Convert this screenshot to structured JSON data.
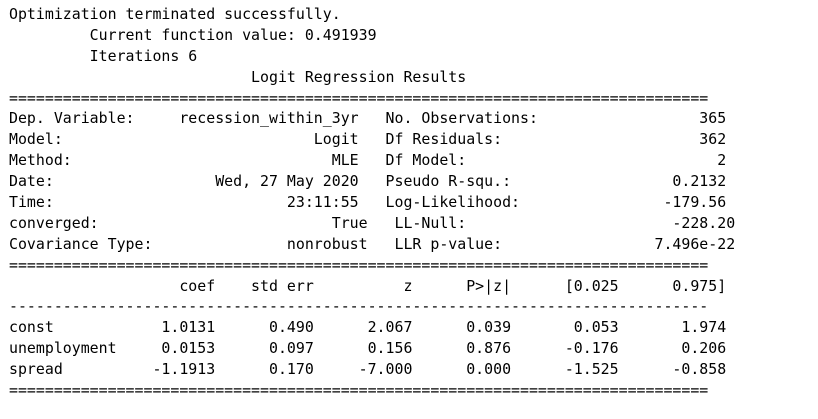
{
  "output_lines": [
    "Optimization terminated successfully.",
    "         Current function value: 0.491939",
    "         Iterations 6",
    "                           Logit Regression Results                           ",
    "==============================================================================",
    "Dep. Variable:     recession_within_3yr   No. Observations:                  365",
    "Model:                            Logit   Df Residuals:                      362",
    "Method:                             MLE   Df Model:                            2",
    "Date:                  Wed, 27 May 2020   Pseudo R-squ.:                  0.2132",
    "Time:                          23:11:55   Log-Likelihood:                -179.56",
    "converged:                          True   LL-Null:                       -228.20",
    "Covariance Type:               nonrobust   LLR p-value:                 7.496e-22",
    "==============================================================================",
    "                   coef    std err          z      P>|z|      [0.025      0.975]",
    "------------------------------------------------------------------------------",
    "const            1.0131      0.490      2.067      0.039       0.053       1.974",
    "unemployment     0.0153      0.097      0.156      0.876      -0.176       0.206",
    "spread          -1.1913      0.170     -7.000      0.000      -1.525      -0.858",
    "=============================================================================="
  ]
}
